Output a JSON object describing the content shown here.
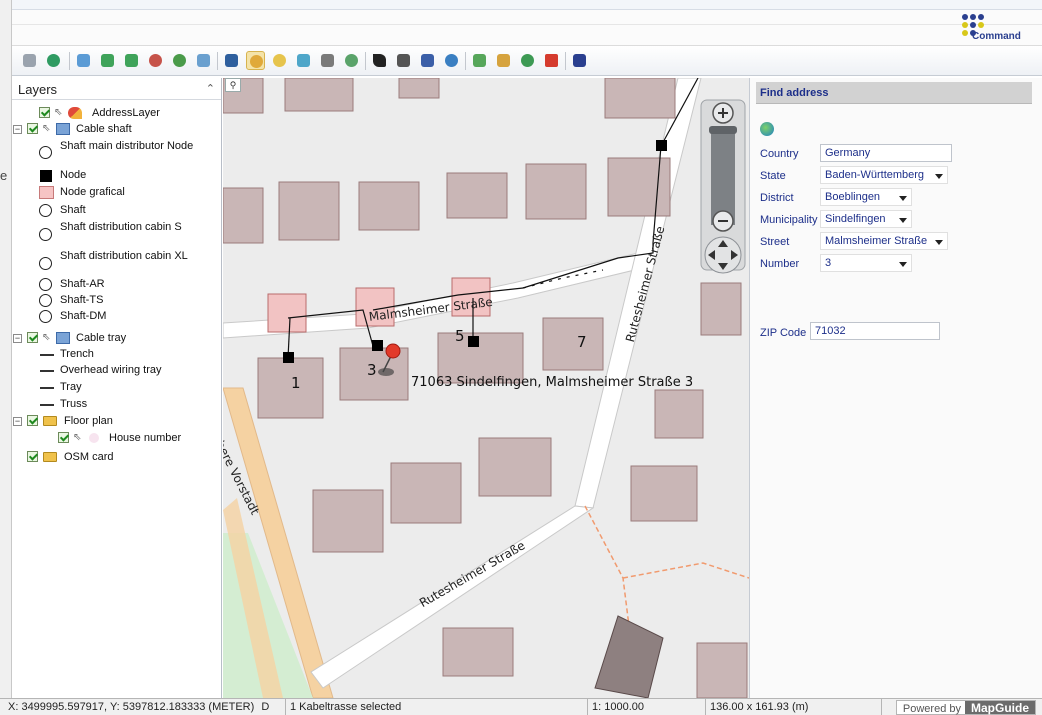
{
  "app": {
    "logo_name": "Command"
  },
  "toolbar": {
    "buttons": [
      "print-icon",
      "refresh-icon",
      "zoom-select-icon",
      "pan-back-icon",
      "pan-forward-icon",
      "zoom-out-icon",
      "zoom-in-icon",
      "zoom-extent-icon",
      "pan-hand-icon",
      "zoom-window-icon",
      "zoom-map-icon",
      "measure-icon",
      "overview-icon",
      "select-arrow-icon",
      "select-region-icon",
      "clear-selection-icon",
      "refresh-map-icon",
      "layer-edit-icon",
      "digitize-icon",
      "buffer-icon",
      "delete-icon",
      "command-grid-icon"
    ],
    "active": "pan-hand-icon"
  },
  "layers": {
    "title": "Layers",
    "items": [
      {
        "label": "AddressLayer"
      },
      {
        "label": "Cable shaft"
      },
      {
        "label": "Shaft main distributor Node"
      },
      {
        "label": "Node"
      },
      {
        "label": "Node grafical"
      },
      {
        "label": "Shaft"
      },
      {
        "label": "Shaft distribution cabin S"
      },
      {
        "label": "Shaft distribution cabin XL"
      },
      {
        "label": "Shaft-AR"
      },
      {
        "label": "Shaft-TS"
      },
      {
        "label": "Shaft-DM"
      },
      {
        "label": "Cable tray"
      },
      {
        "label": "Trench"
      },
      {
        "label": "Overhead wiring tray"
      },
      {
        "label": "Tray"
      },
      {
        "label": "Truss"
      },
      {
        "label": "Floor plan"
      },
      {
        "label": "House number"
      },
      {
        "label": "OSM card"
      }
    ]
  },
  "map": {
    "street_labels": [
      "Malmsheimer Straße",
      "Rutesheimer Straße",
      "Rutesheimer Straße",
      "Obere Vorstadt"
    ],
    "house_numbers": [
      "1",
      "3",
      "5",
      "7"
    ],
    "address_label": "71063 Sindelfingen, Malmsheimer Straße 3",
    "zoom_search_glyph": "⚲"
  },
  "find_address": {
    "title": "Find address",
    "country_label": "Country",
    "country_value": "Germany",
    "state_label": "State",
    "state_value": "Baden-Württemberg",
    "district_label": "District",
    "district_value": "Boeblingen",
    "municipality_label": "Municipality",
    "municipality_value": "Sindelfingen",
    "street_label": "Street",
    "street_value": "Malmsheimer Straße",
    "number_label": "Number",
    "number_value": "3",
    "zip_label": "ZIP Code",
    "zip_value": "71032"
  },
  "status": {
    "coords": "X: 3499995.597917, Y: 5397812.183333 (METER)",
    "selection_prefix": "D",
    "selection": "1 Kabeltrasse selected",
    "scale": "1: 1000.00",
    "size": "136.00 x 161.93 (m)",
    "powered_by": "Powered by",
    "brand": "MapGuide"
  }
}
